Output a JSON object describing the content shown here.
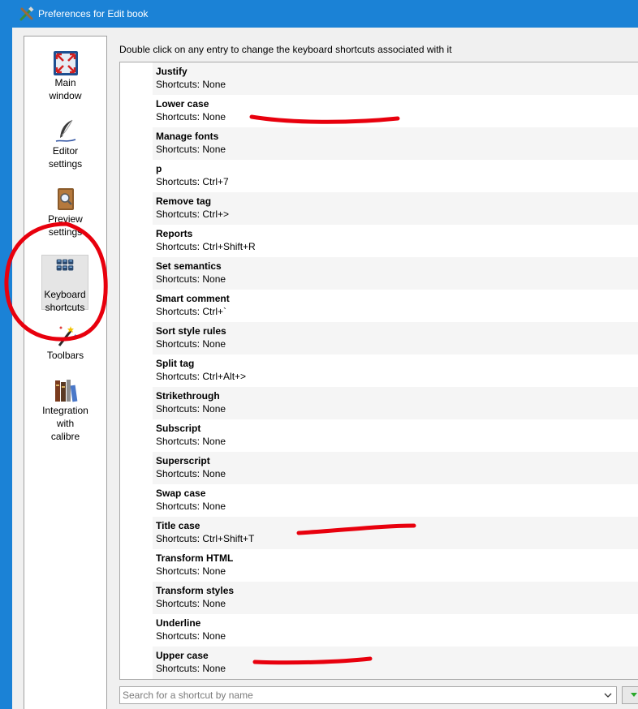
{
  "window": {
    "title": "Preferences for Edit book"
  },
  "sidebar": {
    "items": [
      {
        "label": "Main\nwindow",
        "icon": "maximize-icon"
      },
      {
        "label": "Editor\nsettings",
        "icon": "quill-pen-icon"
      },
      {
        "label": "Preview\nsettings",
        "icon": "book-magnifier-icon"
      },
      {
        "label": "Keyboard\nshortcuts",
        "icon": "keyboard-icon",
        "selected": true
      },
      {
        "label": "Toolbars",
        "icon": "magic-wand-icon"
      },
      {
        "label": "Integration\nwith\ncalibre",
        "icon": "books-icon"
      }
    ]
  },
  "main": {
    "instruction": "Double click on any entry to change the keyboard shortcuts associated with it",
    "shortcuts": [
      {
        "name": "Justify",
        "shortcut": "Shortcuts: None"
      },
      {
        "name": "Lower case",
        "shortcut": "Shortcuts: None"
      },
      {
        "name": "Manage fonts",
        "shortcut": "Shortcuts: None"
      },
      {
        "name": "p",
        "shortcut": "Shortcuts: Ctrl+7"
      },
      {
        "name": "Remove tag",
        "shortcut": "Shortcuts: Ctrl+>"
      },
      {
        "name": "Reports",
        "shortcut": "Shortcuts: Ctrl+Shift+R"
      },
      {
        "name": "Set semantics",
        "shortcut": "Shortcuts: None"
      },
      {
        "name": "Smart comment",
        "shortcut": "Shortcuts: Ctrl+`"
      },
      {
        "name": "Sort style rules",
        "shortcut": "Shortcuts: None"
      },
      {
        "name": "Split tag",
        "shortcut": "Shortcuts: Ctrl+Alt+>"
      },
      {
        "name": "Strikethrough",
        "shortcut": "Shortcuts: None"
      },
      {
        "name": "Subscript",
        "shortcut": "Shortcuts: None"
      },
      {
        "name": "Superscript",
        "shortcut": "Shortcuts: None"
      },
      {
        "name": "Swap case",
        "shortcut": "Shortcuts: None"
      },
      {
        "name": "Title case",
        "shortcut": "Shortcuts: Ctrl+Shift+T"
      },
      {
        "name": "Transform HTML",
        "shortcut": "Shortcuts: None"
      },
      {
        "name": "Transform styles",
        "shortcut": "Shortcuts: None"
      },
      {
        "name": "Underline",
        "shortcut": "Shortcuts: None"
      },
      {
        "name": "Upper case",
        "shortcut": "Shortcuts: None"
      }
    ]
  },
  "search": {
    "placeholder": "Search for a shortcut by name",
    "value": ""
  },
  "colors": {
    "titlebar": "#1b82d6",
    "annotation": "#e8000d"
  }
}
